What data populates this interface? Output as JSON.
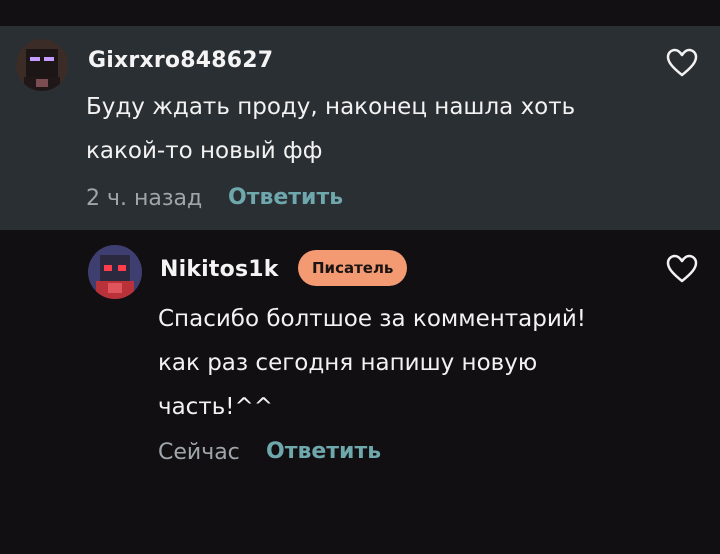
{
  "comment": {
    "author": "Gixrxro848627",
    "text_line1": "Буду ждать проду, наконец нашла хоть",
    "text_line2": "какой-то новый фф",
    "time": "2 ч. назад",
    "reply_label": "Ответить",
    "like_icon": "heart-outline-icon"
  },
  "reply": {
    "author": "Nikitos1k",
    "badge": "Писатель",
    "text_line1": "Спасибо болтшое за комментарий!",
    "text_line2": "как раз сегодня напишу новую",
    "text_line3": "часть!^^",
    "time": "Сейчас",
    "reply_label": "Ответить",
    "like_icon": "heart-outline-icon"
  },
  "colors": {
    "background": "#120f12",
    "highlighted_comment_bg": "#2a2f33",
    "reply_link": "#6ea8ad",
    "badge_bg": "#f39a73",
    "meta_text": "#9fa6ab"
  }
}
